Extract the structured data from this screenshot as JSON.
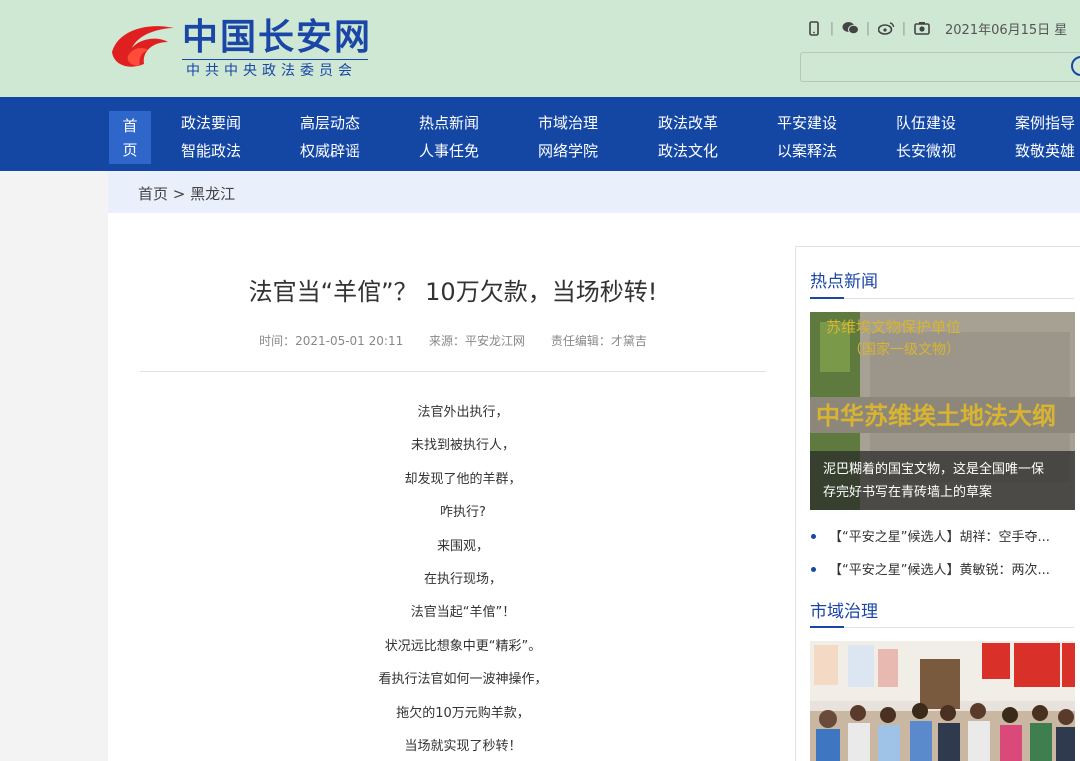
{
  "header": {
    "logo_title": "中国长安网",
    "logo_subtitle": "中共中央政法委员会",
    "date": "2021年06月15日 星",
    "icons": [
      "mobile-icon",
      "wechat-icon",
      "weibo-icon",
      "camera-icon"
    ]
  },
  "nav": {
    "home": [
      "首",
      "页"
    ],
    "row1": [
      "政法要闻",
      "高层动态",
      "热点新闻",
      "市域治理",
      "政法改革",
      "平安建设",
      "队伍建设",
      "案例指导"
    ],
    "row2": [
      "智能政法",
      "权威辟谣",
      "人事任免",
      "网络学院",
      "政法文化",
      "以案释法",
      "长安微视",
      "致敬英雄"
    ]
  },
  "breadcrumb": "首页 > 黑龙江",
  "article": {
    "title": "法官当“羊倌”？ 10万欠款，当场秒转!",
    "time": "时间：2021-05-01 20:11",
    "source": "来源：平安龙江网",
    "editor": "责任编辑：才黛吉",
    "paragraphs": [
      "法官外出执行，",
      "未找到被执行人，",
      "却发现了他的羊群，",
      "咋执行?",
      "来围观，",
      "在执行现场，",
      "法官当起“羊倌”！",
      "状况远比想象中更“精彩”。",
      "看执行法官如何一波神操作，",
      "拖欠的10万元购羊款，",
      "当场就实现了秒转！"
    ]
  },
  "sidebar": {
    "hot_news_title": "热点新闻",
    "feature_caption_line1": "泥巴糊着的国宝文物，这是全国唯一保",
    "feature_caption_line2": "存完好书写在青砖墙上的草案",
    "news": [
      "【“平安之星”候选人】胡祥：空手夺...",
      "【“平安之星”候选人】黄敏锐：两次..."
    ],
    "city_governance_title": "市域治理"
  },
  "colors": {
    "header_bg": "#cfe8d3",
    "nav_bg": "#1447a4",
    "brand_blue": "#1a46a8",
    "logo_red": "#e02020"
  }
}
